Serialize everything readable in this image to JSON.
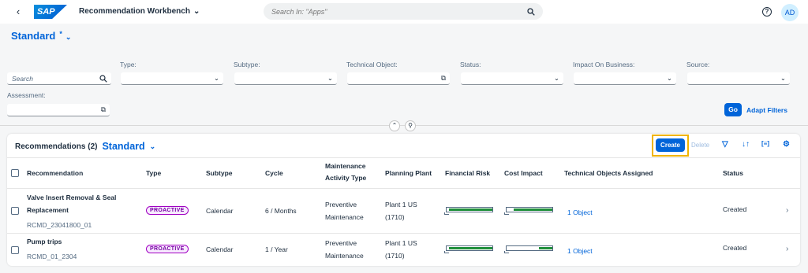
{
  "shell": {
    "back": "‹",
    "logo": "SAP",
    "title": "Recommendation Workbench",
    "search_placeholder": "Search In: \"Apps\"",
    "help": "?",
    "avatar": "AD"
  },
  "variant": {
    "name": "Standard",
    "modified": "*"
  },
  "filters": {
    "search_placeholder": "Search",
    "type": "Type:",
    "subtype": "Subtype:",
    "technical_object": "Technical Object:",
    "status": "Status:",
    "impact": "Impact On Business:",
    "source": "Source:",
    "assessment": "Assessment:",
    "go": "Go",
    "adapt": "Adapt Filters"
  },
  "table": {
    "title": "Recommendations (2)",
    "variant": "Standard",
    "create": "Create",
    "delete": "Delete",
    "headers": {
      "recommendation": "Recommendation",
      "type": "Type",
      "subtype": "Subtype",
      "cycle": "Cycle",
      "mat1": "Maintenance",
      "mat2": "Activity Type",
      "plant": "Planning Plant",
      "financial": "Financial Risk",
      "cost": "Cost Impact",
      "objects": "Technical Objects Assigned",
      "status": "Status"
    },
    "rows": [
      {
        "title1": "Valve Insert Removal & Seal",
        "title2": "Replacement",
        "id": "RCMD_23041800_01",
        "type": "PROACTIVE",
        "subtype": "Calendar",
        "cycle": "6 / Months",
        "mat1": "Preventive",
        "mat2": "Maintenance",
        "plant1": "Plant 1 US",
        "plant2": "(1710)",
        "financial_risk": 0.95,
        "cost_impact": 0.85,
        "objects": "1 Object",
        "status": "Created",
        "nav": "›"
      },
      {
        "title1": "Pump trips",
        "id": "RCMD_01_2304",
        "type": "PROACTIVE",
        "subtype": "Calendar",
        "cycle": "1 / Year",
        "mat1": "Preventive",
        "mat2": "Maintenance",
        "plant1": "Plant 1 US",
        "plant2": "(1710)",
        "financial_risk": 0.95,
        "cost_impact": 0.3,
        "objects": "1 Object",
        "status": "Created",
        "nav": "›"
      }
    ]
  }
}
